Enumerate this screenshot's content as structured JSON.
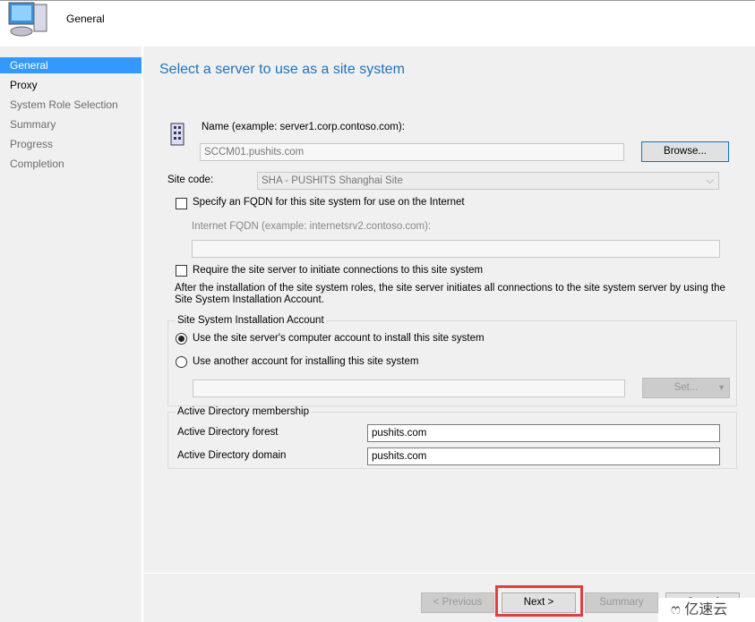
{
  "header": {
    "title": "General",
    "icon": "computer-icon"
  },
  "nav": {
    "items": [
      {
        "label": "General",
        "state": "selected"
      },
      {
        "label": "Proxy",
        "state": "enabled"
      },
      {
        "label": "System Role Selection",
        "state": "disabled"
      },
      {
        "label": "Summary",
        "state": "disabled"
      },
      {
        "label": "Progress",
        "state": "disabled"
      },
      {
        "label": "Completion",
        "state": "disabled"
      }
    ]
  },
  "main": {
    "title": "Select a server to use as a site system",
    "name_label": "Name (example: server1.corp.contoso.com):",
    "name_value": "SCCM01.pushits.com",
    "browse_label": "Browse...",
    "site_code_label": "Site code:",
    "site_code_value": "SHA - PUSHITS Shanghai Site",
    "fqdn_checkbox": "Specify an FQDN for this site system for use on the Internet",
    "fqdn_checked": false,
    "internet_fqdn_label": "Internet FQDN (example: internetsrv2.contoso.com):",
    "internet_fqdn_value": "",
    "require_checkbox": "Require the site server to initiate connections to this site system",
    "require_checked": false,
    "require_note": "After the  installation of the site system roles, the site server initiates all connections to the site system server by using the Site System Installation Account.",
    "install_group": {
      "title": "Site System Installation Account",
      "radio1": "Use the site server's computer account to install this site system",
      "radio2": "Use another account for installing this site system",
      "selected": 1,
      "account_value": "",
      "set_label": "Set..."
    },
    "ad_group": {
      "title": "Active Directory membership",
      "forest_label": "Active Directory forest",
      "forest_value": "pushits.com",
      "domain_label": "Active Directory domain",
      "domain_value": "pushits.com"
    }
  },
  "footer": {
    "previous": "< Previous",
    "next": "Next >",
    "summary": "Summary",
    "cancel": "Cancel"
  },
  "watermark": "亿速云",
  "colors": {
    "accent": "#3399ff",
    "title": "#1e73be",
    "highlight": "#e04040"
  }
}
